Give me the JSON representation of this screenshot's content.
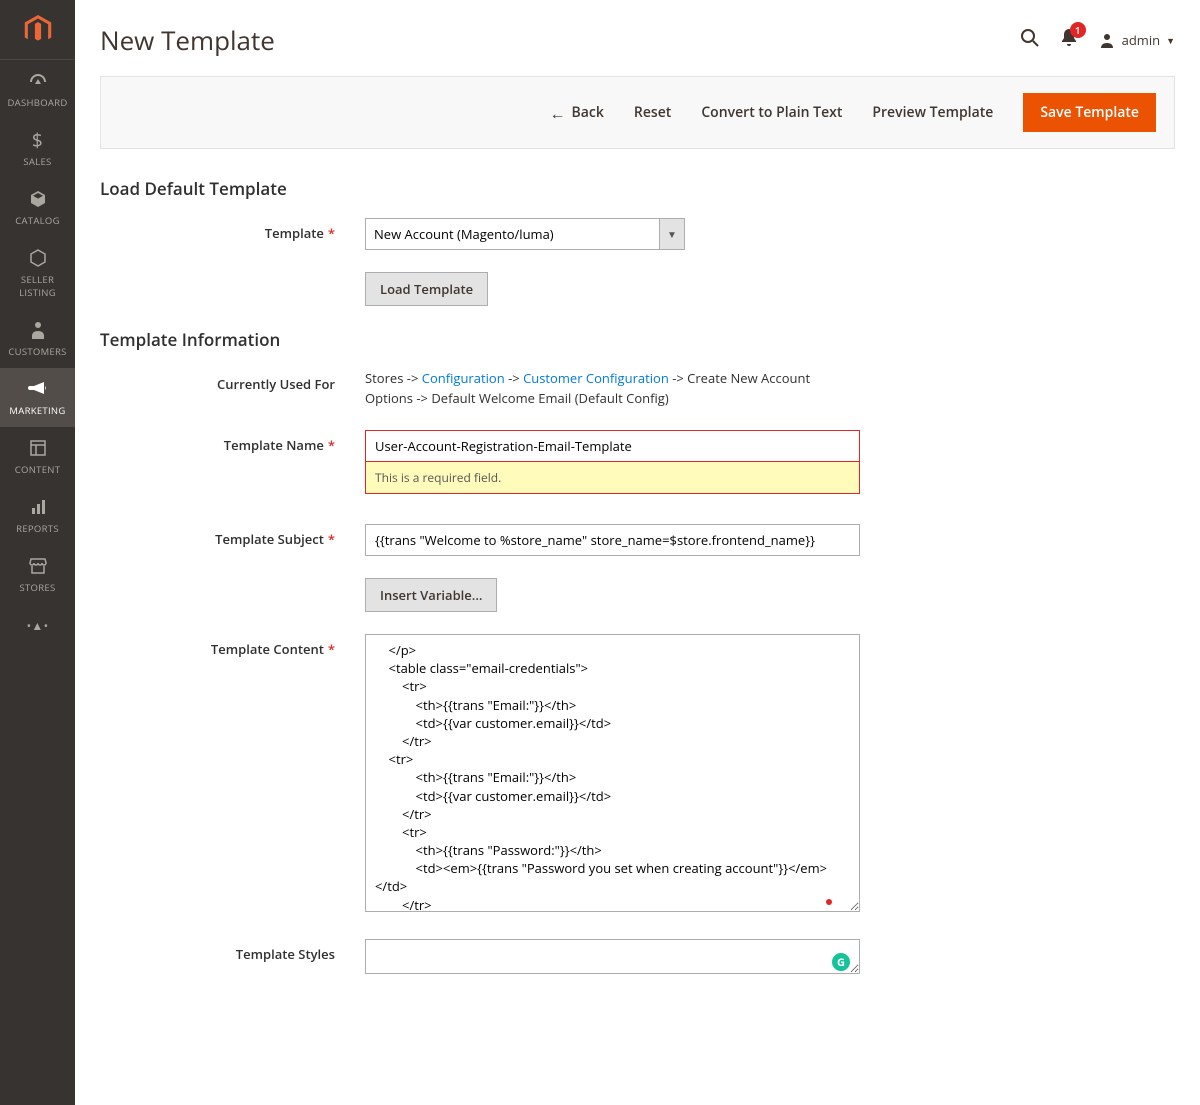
{
  "header": {
    "title": "New Template",
    "notif_count": "1",
    "user": "admin"
  },
  "actions": {
    "back": "Back",
    "reset": "Reset",
    "convert": "Convert to Plain Text",
    "preview": "Preview Template",
    "save": "Save Template"
  },
  "nav": {
    "dashboard": "DASHBOARD",
    "sales": "SALES",
    "catalog": "CATALOG",
    "seller": "SELLER LISTING",
    "customers": "CUSTOMERS",
    "marketing": "MARKETING",
    "content": "CONTENT",
    "reports": "REPORTS",
    "stores": "STORES"
  },
  "section1": {
    "title": "Load Default Template",
    "template_label": "Template",
    "template_value": "New Account (Magento/luma)",
    "load_btn": "Load Template"
  },
  "section2": {
    "title": "Template Information",
    "used_for_label": "Currently Used For",
    "used_for_prefix": "Stores -> ",
    "used_for_link1": "Configuration",
    "used_for_mid": " -> ",
    "used_for_link2": "Customer Configuration",
    "used_for_suffix": " -> Create New Account Options -> Default Welcome Email  (Default Config)",
    "name_label": "Template Name",
    "name_value": "User-Account-Registration-Email-Template",
    "name_error": "This is a required field.",
    "subject_label": "Template Subject",
    "subject_value": "{{trans \"Welcome to %store_name\" store_name=$store.frontend_name}}",
    "insert_var": "Insert Variable...",
    "content_label": "Template Content",
    "content_value": "    </p>\n    <table class=\"email-credentials\">\n        <tr>\n            <th>{{trans \"Email:\"}}</th>\n            <td>{{var customer.email}}</td>\n        </tr>\n    <tr>\n            <th>{{trans \"Email:\"}}</th>\n            <td>{{var customer.email}}</td>\n        </tr>\n        <tr>\n            <th>{{trans \"Password:\"}}</th>\n            <td><em>{{trans \"Password you set when creating account\"}}</em></td>\n        </tr>\n    </table>\n    <p>\n        {{trans\n            'Forgot your account password? Click <a href=\"%reset_url\">here</a> to reset it.'\n\n            reset_url=\"$this.getUrl($store,'customer/account/createPassword/',[_query:",
    "styles_label": "Template Styles",
    "styles_value": ""
  }
}
